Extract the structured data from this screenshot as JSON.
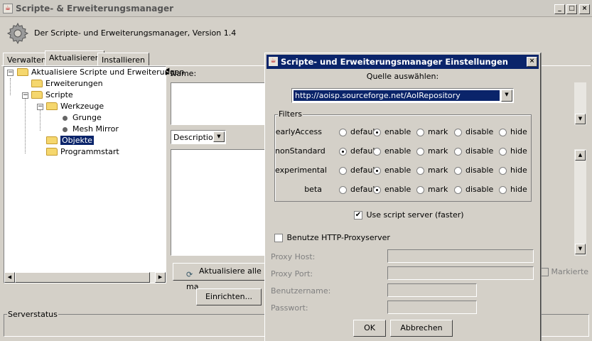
{
  "window": {
    "title": "Scripte- & Erweiterungsmanager",
    "controls": [
      "_",
      "□",
      "×"
    ]
  },
  "header": {
    "text": "Der Scripte- und Erweiterungsmanager, Version 1.4"
  },
  "tabs": [
    {
      "label": "Verwalten"
    },
    {
      "label": "Aktualisieren"
    },
    {
      "label": "Installieren"
    }
  ],
  "tree": {
    "items": [
      {
        "label": "Aktualisiere Scripte und Erweiterungen",
        "type": "folder",
        "expander": "−"
      },
      {
        "label": "Erweiterungen",
        "type": "folder"
      },
      {
        "label": "Scripte",
        "type": "folder",
        "expander": "−"
      },
      {
        "label": "Werkzeuge",
        "type": "folder",
        "expander": "−"
      },
      {
        "label": "Grunge",
        "type": "leaf"
      },
      {
        "label": "Mesh Mirror",
        "type": "leaf"
      },
      {
        "label": "Objekte",
        "type": "folder",
        "selected": true
      },
      {
        "label": "Programmstart",
        "type": "folder"
      }
    ]
  },
  "right_panel": {
    "name_label": "Name:",
    "description_option": "Description",
    "update_button": "Aktualisiere alle ma",
    "marked_label": "Markierte"
  },
  "bottom": {
    "setup_button": "Einrichten...",
    "server_status_label": "Serverstatus"
  },
  "dialog": {
    "title": "Scripte- und Erweiterungsmanager Einstellungen",
    "source_label": "Quelle auswählen:",
    "source_value": "http://aoisp.sourceforge.net/AoIRepository",
    "filters_label": "Filters",
    "filter_options": [
      "default",
      "enable",
      "mark",
      "disable",
      "hide"
    ],
    "filters": [
      {
        "name": "earlyAccess",
        "selected": "enable"
      },
      {
        "name": "nonStandard",
        "selected": "default"
      },
      {
        "name": "experimental",
        "selected": "enable"
      },
      {
        "name": "beta",
        "selected": "enable"
      }
    ],
    "use_script_server": {
      "label": "Use script server (faster)",
      "checked": true
    },
    "http_proxy": {
      "label": "Benutze HTTP-Proxyserver",
      "checked": false
    },
    "proxy_host_label": "Proxy Host:",
    "proxy_port_label": "Proxy Port:",
    "username_label": "Benutzername:",
    "password_label": "Passwort:",
    "ok_button": "OK",
    "cancel_button": "Abbrechen"
  },
  "colors": {
    "face": "#d4d0c8",
    "dialog_title": "#0a246a",
    "selection": "#0a246a",
    "folder": "#f5d76e"
  }
}
